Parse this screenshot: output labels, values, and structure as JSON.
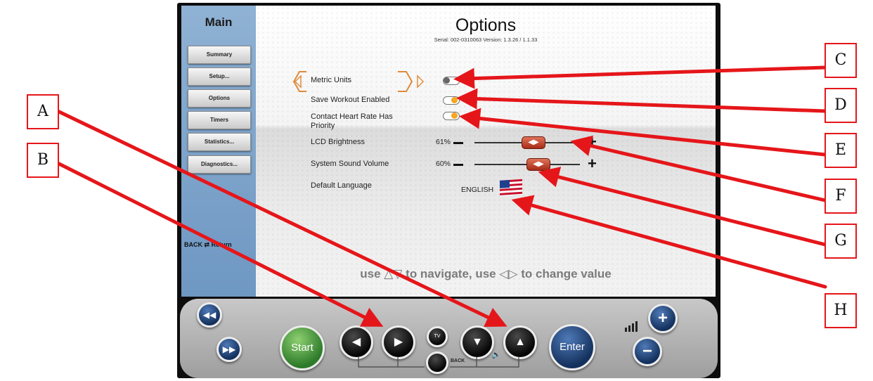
{
  "sidebar": {
    "title": "Main",
    "items": [
      {
        "label": "Summary"
      },
      {
        "label": "Setup..."
      },
      {
        "label": "Options"
      },
      {
        "label": "Timers"
      },
      {
        "label": "Statistics..."
      },
      {
        "label": "Diagnostics..."
      }
    ],
    "back_label": "BACK",
    "return_label": "Return"
  },
  "header": {
    "title": "Options",
    "serial": "Serial: 002-0310063  Version: 1.3.26 / 1.1.33"
  },
  "options": {
    "metric_units": {
      "label": "Metric Units",
      "state": "off"
    },
    "save_workout": {
      "label": "Save Workout Enabled",
      "state": "on"
    },
    "contact_hr": {
      "label_line1": "Contact Heart Rate Has",
      "label_line2": "Priority",
      "state": "on"
    },
    "lcd_brightness": {
      "label": "LCD Brightness",
      "value_text": "61%",
      "value": 61
    },
    "sound_volume": {
      "label": "System Sound Volume",
      "value_text": "60%",
      "value": 60
    },
    "language": {
      "label": "Default Language",
      "value": "ENGLISH"
    }
  },
  "hint": {
    "prefix": "use",
    "up_down": "△▽",
    "middle": "to navigate, use",
    "left_right": "◁▷",
    "suffix": "to change value"
  },
  "controls": {
    "start_label": "Start",
    "enter_label": "Enter",
    "back_label": "BACK",
    "tv_label": "TV"
  },
  "callouts": [
    "A",
    "B",
    "C",
    "D",
    "E",
    "F",
    "G",
    "H"
  ],
  "colors": {
    "arrow": "#e5161a",
    "sidebar": "#7ea3cb",
    "slider_handle": "#c4442b",
    "toggle_on": "#f5a623",
    "start": "#4a9e3c",
    "enter": "#1f3f70"
  }
}
